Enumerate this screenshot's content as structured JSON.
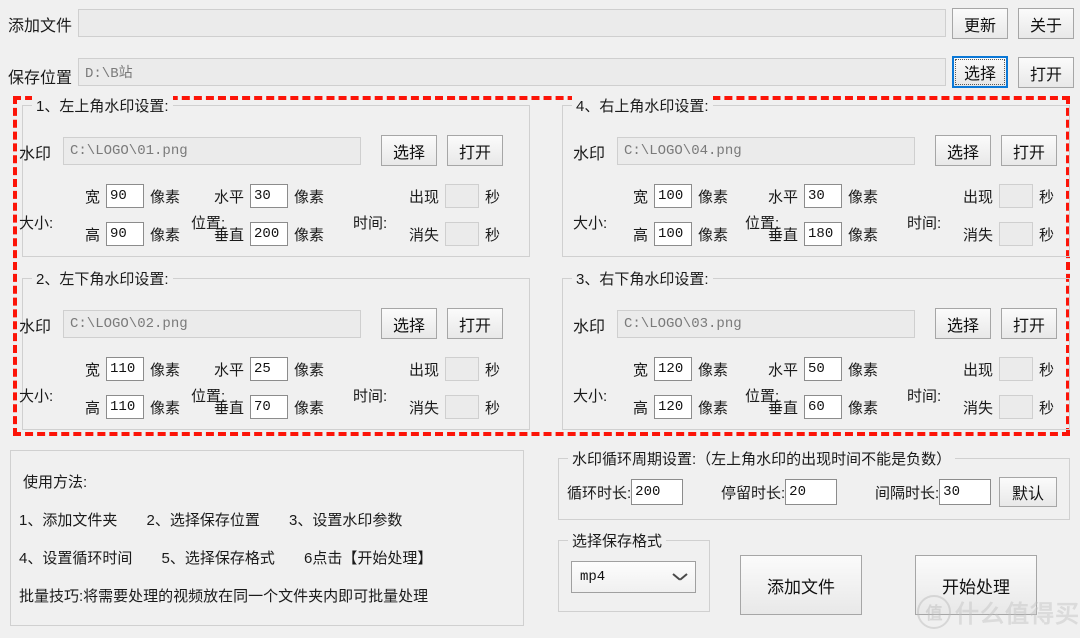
{
  "top": {
    "add_file_label": "添加文件",
    "add_file_value": "",
    "save_path_label": "保存位置",
    "save_path_value": "D:\\B站",
    "update_button": "更新",
    "about_button": "关于",
    "choose_button": "选择",
    "open_button": "打开"
  },
  "common": {
    "watermark_label": "水印",
    "choose_button": "选择",
    "open_button": "打开",
    "size_label": "大小:",
    "position_label": "位置:",
    "time_label": "时间:",
    "width_label": "宽",
    "height_label": "高",
    "horizontal_label": "水平",
    "vertical_label": "垂直",
    "appear_label": "出现",
    "disappear_label": "消失",
    "pixel_unit": "像素",
    "second_unit": "秒"
  },
  "panels": [
    {
      "id": "top-left",
      "title": "1、左上角水印设置:",
      "path": "C:\\LOGO\\01.png",
      "width": "90",
      "height": "90",
      "horizontal": "30",
      "vertical": "200",
      "appear": "",
      "disappear": ""
    },
    {
      "id": "top-right",
      "title": "4、右上角水印设置:",
      "path": "C:\\LOGO\\04.png",
      "width": "100",
      "height": "100",
      "horizontal": "30",
      "vertical": "180",
      "appear": "",
      "disappear": ""
    },
    {
      "id": "bottom-left",
      "title": "2、左下角水印设置:",
      "path": "C:\\LOGO\\02.png",
      "width": "110",
      "height": "110",
      "horizontal": "25",
      "vertical": "70",
      "appear": "",
      "disappear": ""
    },
    {
      "id": "bottom-right",
      "title": "3、右下角水印设置:",
      "path": "C:\\LOGO\\03.png",
      "width": "120",
      "height": "120",
      "horizontal": "50",
      "vertical": "60",
      "appear": "",
      "disappear": ""
    }
  ],
  "help": {
    "line0": "使用方法:",
    "line1": "1、添加文件夹       2、选择保存位置       3、设置水印参数",
    "line2": "4、设置循环时间       5、选择保存格式       6点击【开始处理】",
    "line3": "批量技巧:将需要处理的视频放在同一个文件夹内即可批量处理"
  },
  "cycle": {
    "title": "水印循环周期设置:（左上角水印的出现时间不能是负数）",
    "duration_label": "循环时长:",
    "duration_value": "200",
    "stay_label": "停留时长:",
    "stay_value": "20",
    "interval_label": "间隔时长:",
    "interval_value": "30",
    "default_button": "默认"
  },
  "format": {
    "title": "选择保存格式",
    "selected": "mp4"
  },
  "actions": {
    "add_file_button": "添加文件",
    "start_button": "开始处理"
  },
  "watermark_overlay": {
    "logo": "值",
    "text": "什么值得买"
  },
  "colors": {
    "background": "#f0f0f0",
    "marquee": "#fc1408",
    "focus": "#0a78d7"
  }
}
